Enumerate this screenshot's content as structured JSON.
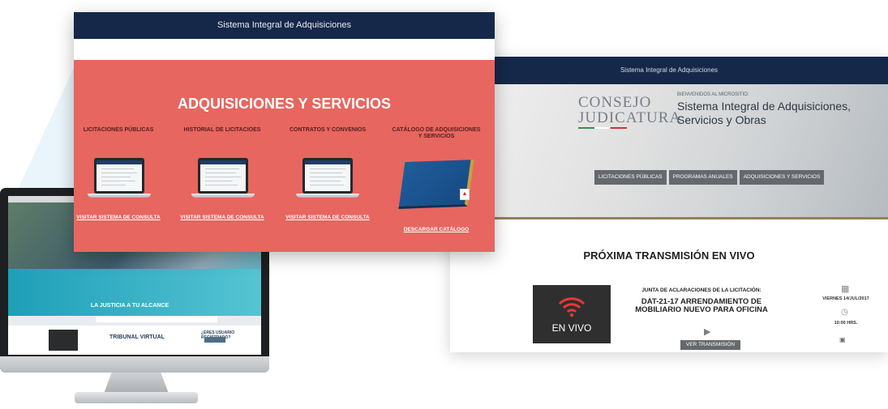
{
  "front_window": {
    "header_title": "Sistema Integral de Adquisiciones",
    "main_title": "ADQUISICIONES Y SERVICIOS",
    "columns": [
      {
        "label": "LICITACIONES PÚBLICAS",
        "link": "VISITAR SISTEMA DE CONSULTA"
      },
      {
        "label": "HISTORIAL DE LICITACIOES",
        "link": "VISITAR SISTEMA DE CONSULTA"
      },
      {
        "label": "CONTRATOS Y CONVENIOS",
        "link": "VISITAR SISTEMA DE CONSULTA"
      },
      {
        "label": "CATÁLOGO DE ADQUISICIONES Y SERVICIOS",
        "link": "DESCARGAR CATÁLOGO"
      }
    ]
  },
  "right_window": {
    "header_title": "Sistema Integral de Adquisiciones",
    "logo_text": "CONSEJO de la JUDICATURA",
    "welcome": "BIENVENIDOS AL MICROSITIO:",
    "site_title": "Sistema Integral de Adquisiciones, Servicios y Obras",
    "nav_tabs": [
      "LICITACIONES PÚBLICAS",
      "PROGRAMAS ANUALES",
      "ADQUISICIONES Y SERVICIOS"
    ],
    "live_title": "PRÓXIMA TRANSMISIÓN EN VIVO",
    "thumb_label": "EN VIVO",
    "junta": "JUNTA DE ACLARACIONES DE LA LICITACIÓN:",
    "event_title": "DAT-21-17 ARRENDAMIENTO DE MOBILIARIO NUEVO PARA OFICINA",
    "watch_button": "VER TRANSMISIÓN",
    "date": "VIERNES 14/JUL/2017",
    "time": "10:00 HRS."
  },
  "monitor_screen": {
    "hero_text": "LA JUSTICIA A TU ALCANCE",
    "section_title": "TRIBUNAL VIRTUAL",
    "user_question": "¿ERES USUARIO REGISTRADO?"
  },
  "colors": {
    "navy": "#15284a",
    "coral": "#e7665f",
    "gray_tab": "#65696d",
    "live_red": "#e53935",
    "gold_rule": "#8e8258"
  }
}
